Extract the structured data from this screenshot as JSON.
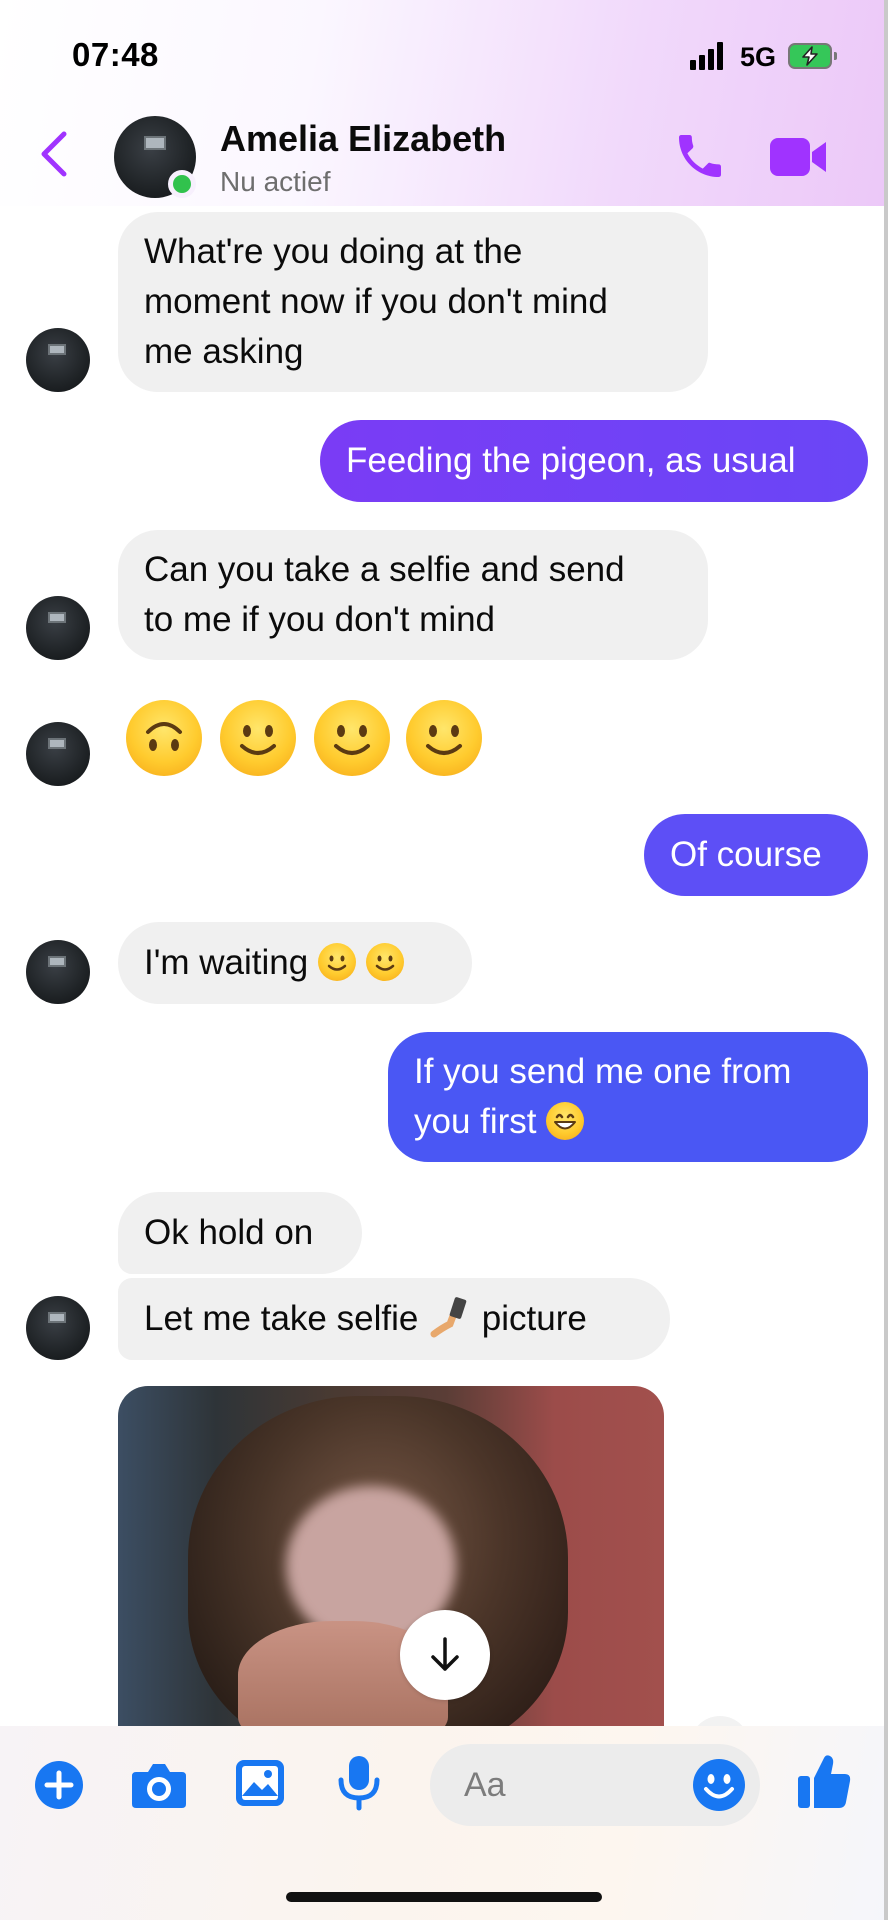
{
  "status_bar": {
    "time": "07:48",
    "network": "5G",
    "icons": [
      "signal-bars-icon",
      "battery-charging-icon"
    ]
  },
  "header": {
    "contact_name": "Amelia Elizabeth",
    "contact_status": "Nu actief",
    "icons": [
      "back-chevron-icon",
      "phone-call-icon",
      "video-call-icon"
    ],
    "accent_color": "#a033ff",
    "online_color": "#31c24d"
  },
  "messages": [
    {
      "sender": "contact",
      "lines": [
        "What're you doing at the",
        "moment now if you don't mind",
        "me asking"
      ]
    },
    {
      "sender": "me",
      "lines": [
        "Feeding the pigeon, as usual"
      ]
    },
    {
      "sender": "contact",
      "lines": [
        "Can you take a selfie and send",
        "to me if you don't mind"
      ]
    },
    {
      "sender": "contact",
      "emojis": [
        "upside-down-face-emoji",
        "slightly-smiling-face-emoji",
        "slightly-smiling-face-emoji",
        "slightly-smiling-face-emoji"
      ]
    },
    {
      "sender": "me",
      "lines": [
        "Of course"
      ]
    },
    {
      "sender": "contact",
      "lines": [
        "I'm waiting"
      ],
      "trailing_emojis": [
        "slightly-smiling-face-emoji",
        "slightly-smiling-face-emoji"
      ]
    },
    {
      "sender": "me",
      "lines": [
        "If you send me one from",
        "you first"
      ],
      "trailing_emojis": [
        "grinning-face-emoji"
      ]
    },
    {
      "sender": "contact",
      "lines": [
        "Ok hold on"
      ]
    },
    {
      "sender": "contact",
      "lines": [
        "Let me take selfie",
        "picture"
      ],
      "inline_emoji": "selfie-emoji"
    },
    {
      "sender": "contact",
      "attachment": "photo",
      "action_icon": "download-arrow-icon"
    }
  ],
  "composer": {
    "placeholder": "Aa",
    "icons": [
      "plus-icon",
      "camera-icon",
      "gallery-icon",
      "microphone-icon",
      "emoji-icon",
      "thumbs-up-icon"
    ]
  },
  "colors": {
    "incoming_bubble": "#f0f0f0",
    "outgoing_gradient": [
      "#7a3cf5",
      "#5b50f7",
      "#4a57f4"
    ],
    "composer_icon": "#1877f2"
  }
}
